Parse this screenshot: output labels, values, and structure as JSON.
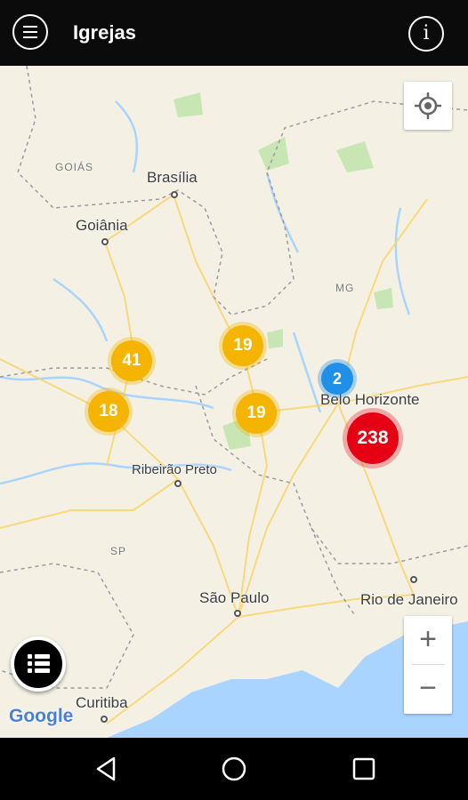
{
  "app": {
    "title": "Igrejas",
    "info_glyph": "i"
  },
  "map": {
    "places": [
      {
        "id": "brasilia",
        "name": "Brasília"
      },
      {
        "id": "goiania",
        "name": "Goiânia"
      },
      {
        "id": "belo-horizonte",
        "name": "Belo Horizonte"
      },
      {
        "id": "ribeirao-preto",
        "name": "Ribeirão Preto"
      },
      {
        "id": "sao-paulo",
        "name": "São Paulo"
      },
      {
        "id": "rio-de-janeiro",
        "name": "Rio de Janeiro"
      },
      {
        "id": "curitiba",
        "name": "Curitiba"
      }
    ],
    "region_labels": {
      "goias": "GOIÁS",
      "mg": "MG",
      "sp": "SP"
    },
    "clusters": [
      {
        "id": "cluster-41",
        "count": "41",
        "color": "#f5b400"
      },
      {
        "id": "cluster-19-north",
        "count": "19",
        "color": "#f5b400"
      },
      {
        "id": "cluster-18",
        "count": "18",
        "color": "#f5b400"
      },
      {
        "id": "cluster-19-south",
        "count": "19",
        "color": "#f5b400"
      },
      {
        "id": "cluster-2",
        "count": "2",
        "color": "#1f8fe8"
      },
      {
        "id": "cluster-238",
        "count": "238",
        "color": "#e60014"
      }
    ],
    "attribution": "Google",
    "zoom_in": "+",
    "zoom_out": "−"
  },
  "colors": {
    "appbar": "#0b0b0b",
    "water": "#a9d4ff",
    "land": "#f4f1e4"
  }
}
